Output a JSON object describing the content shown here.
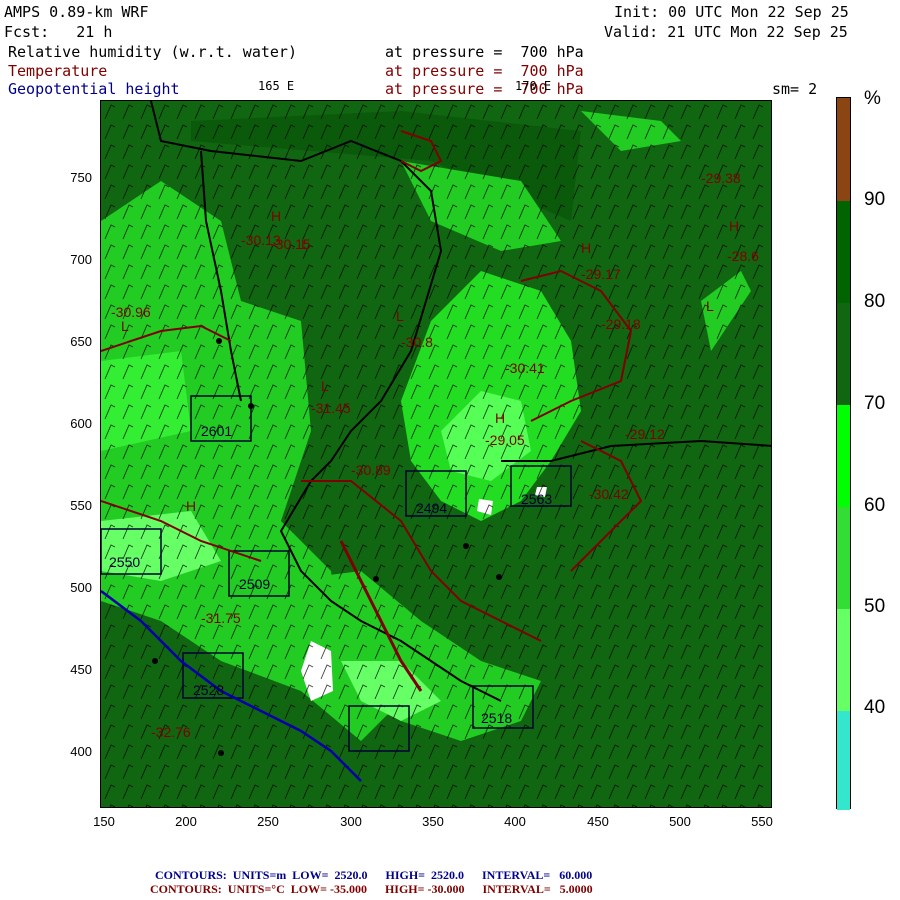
{
  "header": {
    "model": "AMPS 0.89-km WRF",
    "init": "Init: 00 UTC Mon 22 Sep 25",
    "forecast": "Fcst:   21 h",
    "valid": "Valid: 21 UTC Mon 22 Sep 25",
    "field1_name": "Relative humidity (w.r.t. water)",
    "field1_level": "at pressure =  700 hPa",
    "field2_name": "Temperature",
    "field2_level": "at pressure =  700 hPa",
    "field3_name": "Geopotential height",
    "field3_level": "at pressure =  700 hPa",
    "lon_label": "165 E",
    "lon_label2": "170 E",
    "smoothing": "sm= 2"
  },
  "axes": {
    "y_ticks": [
      "750",
      "700",
      "650",
      "600",
      "550",
      "500",
      "450",
      "400"
    ],
    "x_ticks": [
      "150",
      "200",
      "250",
      "300",
      "350",
      "400",
      "450",
      "500",
      "550"
    ]
  },
  "colorbar": {
    "unit": "%",
    "labels": [
      "90",
      "80",
      "70",
      "60",
      "50",
      "40"
    ],
    "colors": [
      "#8b4513",
      "#006400",
      "#116611",
      "#00ff00",
      "#33dd33",
      "#66ff66",
      "#33e6cc"
    ]
  },
  "map_labels": {
    "highs": [
      "H",
      "H",
      "H",
      "H",
      "H"
    ],
    "lows": [
      "L",
      "L",
      "L",
      "L",
      "L"
    ],
    "temps": [
      "-29.38",
      "-29.17",
      "-28.6",
      "-30.8",
      "-30.96",
      "-31.45",
      "-30.89",
      "-29.05",
      "-29.12",
      "-29.18",
      "-30.42",
      "-31.75",
      "-32.76",
      "-30.15",
      "-30.13",
      "-30.41"
    ],
    "heights": [
      "2601",
      "2494",
      "2563",
      "2509",
      "2528",
      "2550",
      "2518"
    ]
  },
  "footer": {
    "line1": "CONTOURS:  UNITS=m  LOW=  2520.0      HIGH=  2520.0      INTERVAL=   60.000",
    "line2": "CONTOURS:  UNITS=°C  LOW= -35.000      HIGH= -30.000      INTERVAL=   5.0000"
  }
}
